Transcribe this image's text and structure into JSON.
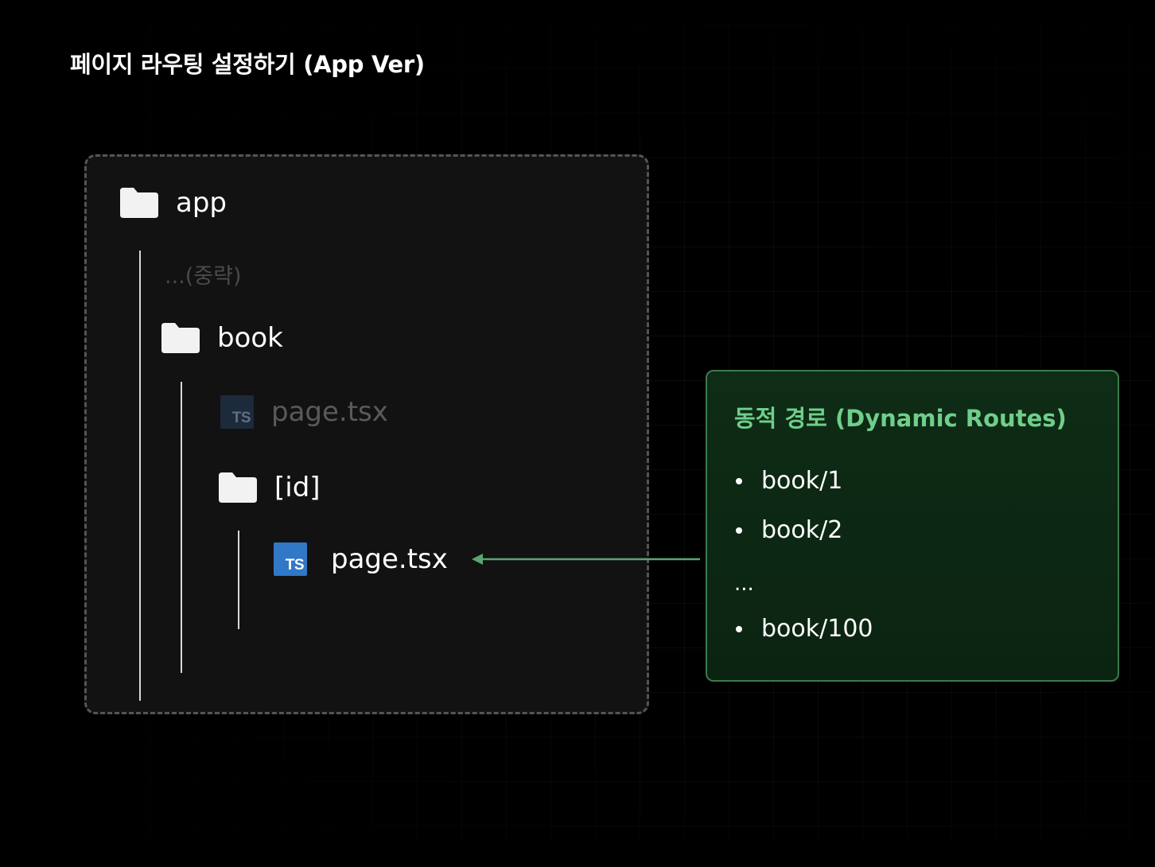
{
  "page": {
    "title": "페이지 라우팅 설정하기 (App Ver)"
  },
  "tree": {
    "root_label": "app",
    "omitted_label": "...(중략)",
    "book_label": "book",
    "book_page_label": "page.tsx",
    "id_folder_label": "[id]",
    "id_page_label": "page.tsx",
    "ts_badge": "TS"
  },
  "routes": {
    "title": "동적 경로 (Dynamic Routes)",
    "items": [
      "book/1",
      "book/2",
      "book/100"
    ],
    "ellipsis": "..."
  },
  "colors": {
    "background": "#000000",
    "panel": "#121212",
    "accent_green": "#6fcf8a",
    "route_border": "#3d7a4d",
    "ts_blue": "#3178c6"
  },
  "icons": {
    "folder": "folder-icon",
    "typescript": "typescript-file-icon",
    "arrow": "arrow-left-icon"
  }
}
